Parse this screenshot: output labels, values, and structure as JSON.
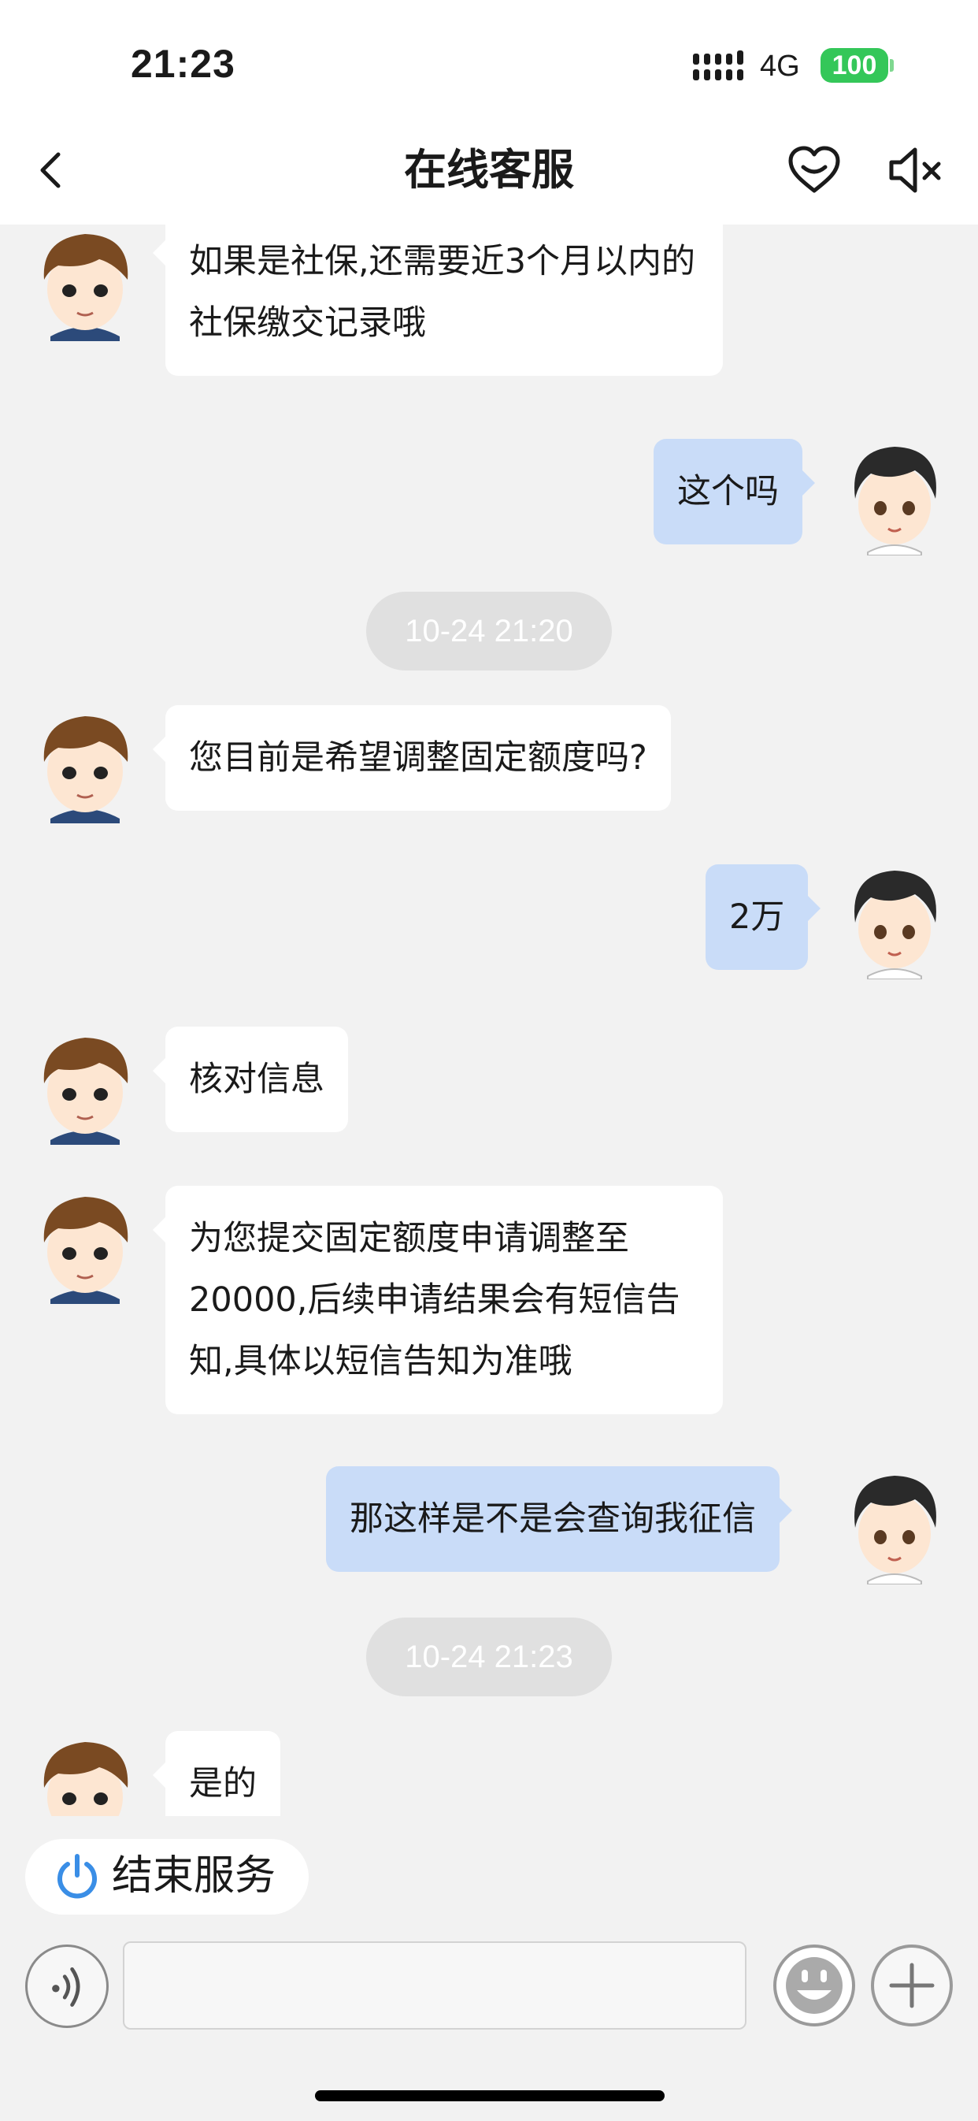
{
  "status_bar": {
    "time": "21:23",
    "network": "4G",
    "battery": "100",
    "battery_color": "#34c759"
  },
  "header": {
    "title": "在线客服",
    "back_icon": "chevron-left-icon",
    "favorite_icon": "heart-icon",
    "mute_icon": "speaker-muted-icon"
  },
  "messages": [
    {
      "sender": "agent",
      "text": "如果是社保,还需要近3个月以内的社保缴交记录哦"
    },
    {
      "sender": "user",
      "text": "这个吗"
    },
    {
      "type": "timestamp",
      "text": "10-24 21:20"
    },
    {
      "sender": "agent",
      "text": "您目前是希望调整固定额度吗?"
    },
    {
      "sender": "user",
      "text": "2万"
    },
    {
      "sender": "agent",
      "text": "核对信息"
    },
    {
      "sender": "agent",
      "text": "为您提交固定额度申请调整至20000,后续申请结果会有短信告知,具体以短信告知为准哦"
    },
    {
      "sender": "user",
      "text": "那这样是不是会查询我征信"
    },
    {
      "type": "timestamp",
      "text": "10-24 21:23"
    },
    {
      "sender": "agent",
      "text": "是的"
    }
  ],
  "footer": {
    "end_service_label": "结束服务",
    "end_service_icon": "power-icon",
    "end_service_color": "#3a8ee6",
    "voice_icon": "voice-wave-icon",
    "input_value": "",
    "emoji_icon": "smiley-icon",
    "plus_icon": "plus-icon"
  },
  "colors": {
    "user_bubble": "#c9dcf8",
    "agent_bubble": "#ffffff",
    "chat_background": "#f2f2f2"
  }
}
